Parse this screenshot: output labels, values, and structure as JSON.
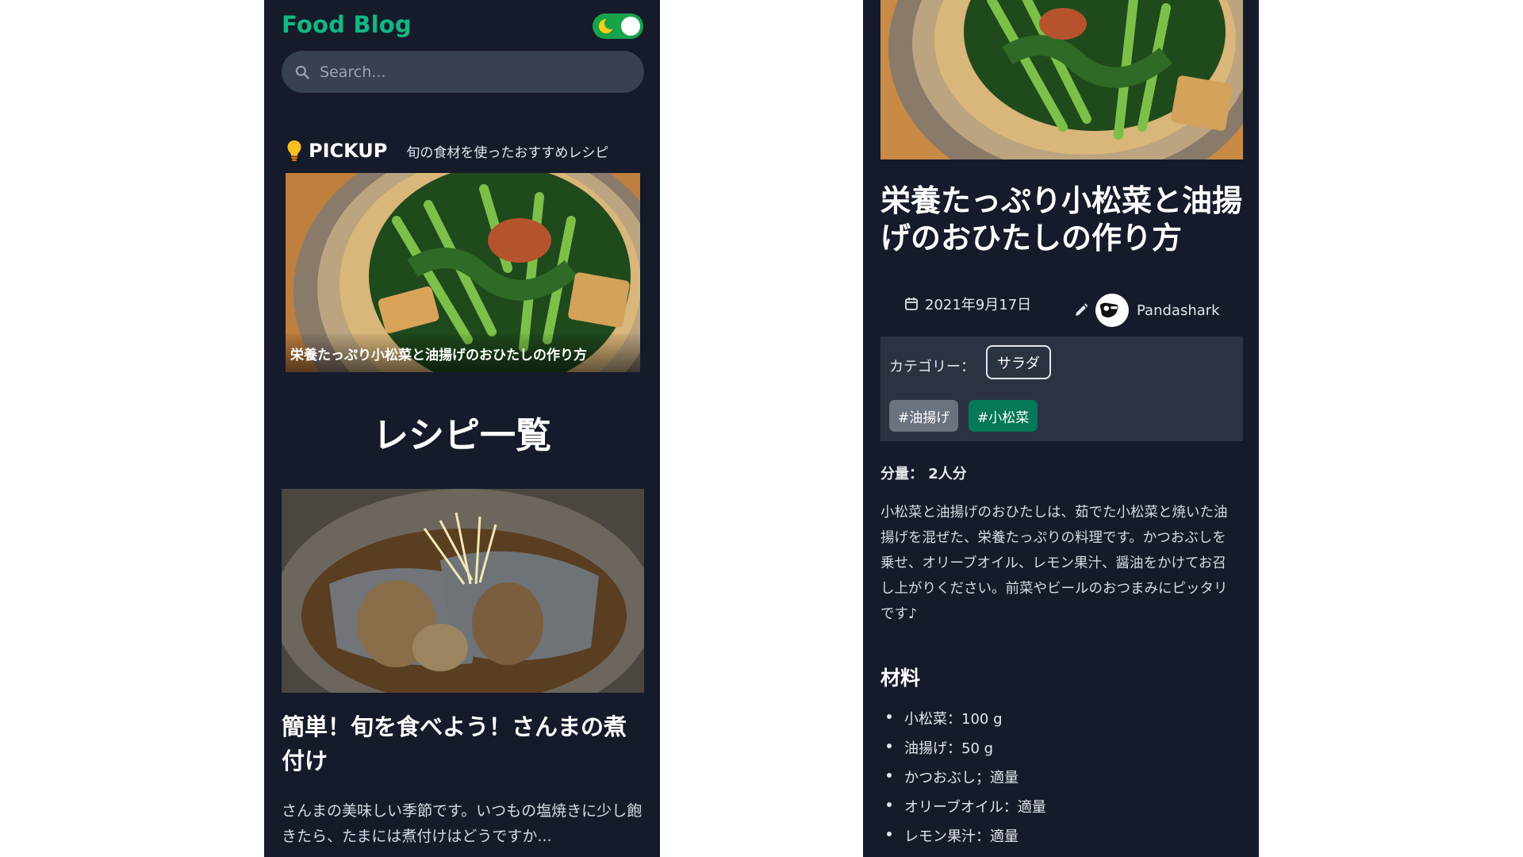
{
  "header": {
    "brand": "Food Blog",
    "search_placeholder": "Search..."
  },
  "pickup": {
    "title": "PICKUP",
    "subtitle": "旬の食材を使ったおすすめレシピ",
    "card_caption": "栄養たっぷり小松菜と油揚げのおひたしの作り方"
  },
  "recipes_section": {
    "title": "レシピ一覧",
    "item": {
      "title": "簡単！旬を食べよう！さんまの煮付け",
      "excerpt": "さんまの美味しい季節です。いつもの塩焼きに少し飽きたら、たまには煮付けはどうですか..."
    }
  },
  "article": {
    "title": "栄養たっぷり小松菜と油揚げのおひたしの作り方",
    "date": "2021年9月17日",
    "author": "Pandashark",
    "category_label": "カテゴリー：",
    "category": "サラダ",
    "tags": [
      "#油揚げ",
      "#小松菜"
    ],
    "servings": "分量： 2人分",
    "description": "小松菜と油揚げのおひたしは、茹でた小松菜と焼いた油揚げを混ぜた、栄養たっぷりの料理です。かつおぶしを乗せ、オリーブオイル、レモン果汁、醤油をかけてお召し上がりください。前菜やビールのおつまみにピッタリです♪",
    "ingredients_heading": "材料",
    "ingredients": [
      "小松菜：100 g",
      "油揚げ：50 g",
      "かつおぶし；適量",
      "オリーブオイル：適量",
      "レモン果汁：適量"
    ]
  },
  "colors": {
    "background": "#151b2b",
    "brand": "#10b981",
    "toggle": "#16a34a",
    "tag_primary": "#047857",
    "tag_secondary": "#6b7280",
    "panel": "#2b3342"
  },
  "icons": [
    "search-icon",
    "lightbulb-icon",
    "moon-icon",
    "calendar-icon",
    "pencil-icon",
    "avatar-icon"
  ]
}
